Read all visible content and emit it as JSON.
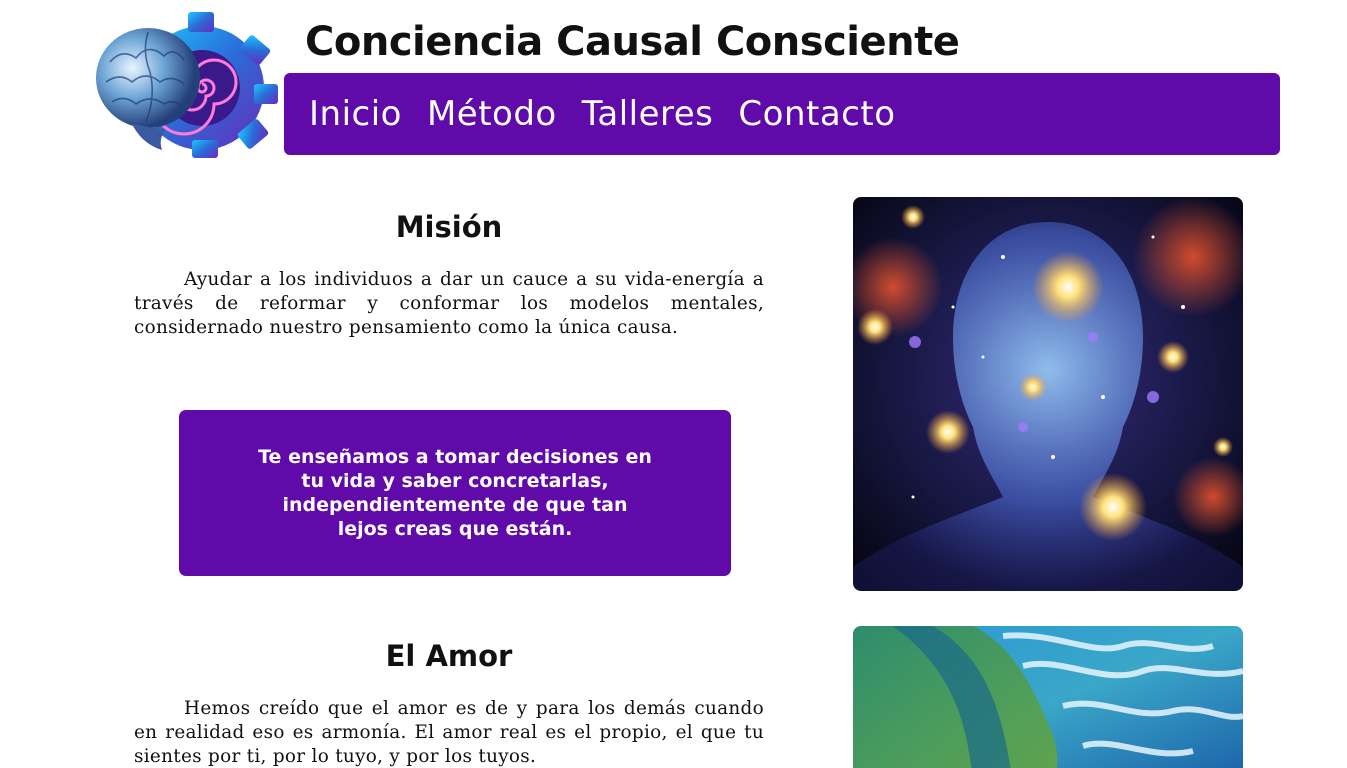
{
  "header": {
    "title": "Conciencia Causal Consciente",
    "logo_icon": "brain-spiral-logo"
  },
  "nav": {
    "items": [
      {
        "label": "Inicio"
      },
      {
        "label": "Método"
      },
      {
        "label": "Talleres"
      },
      {
        "label": "Contacto"
      }
    ]
  },
  "mission": {
    "title": "Misión",
    "text": "Ayudar a los individuos a dar un cauce a su vida-energía a través de reformar y conformar los modelos mentales, considernado nuestro pensamiento como la única causa."
  },
  "callout": {
    "text": "Te enseñamos a tomar decisiones en tu vida y saber concretarlas, independientemente de que tan lejos creas que están."
  },
  "love": {
    "title": "El Amor",
    "text": "Hemos creído que el amor es de y para los demás cuando en realidad eso es armonía. El amor real es el propio, el que tu sientes por ti, por lo tuyo, y por los tuyos."
  },
  "colors": {
    "accent": "#5f0aa9",
    "text": "#111111",
    "background": "#ffffff"
  }
}
